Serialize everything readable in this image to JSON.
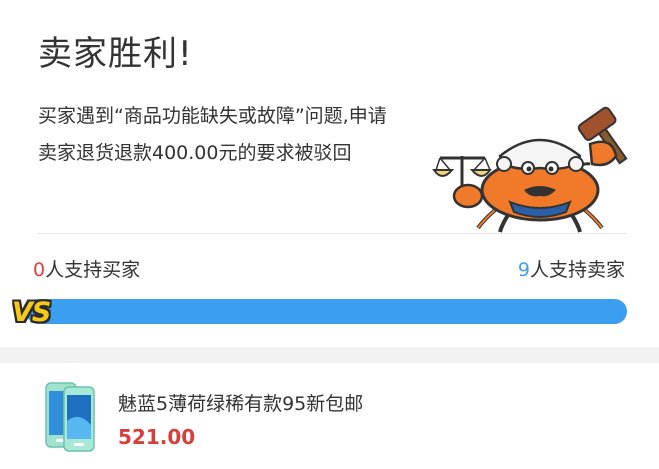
{
  "verdict": {
    "title": "卖家胜利!",
    "description": "买家遇到“商品功能缺失或故障”问题,申请卖家退货退款400.00元的要求被驳回"
  },
  "support": {
    "buyer_count": "0",
    "buyer_label": "人支持买家",
    "seller_count": "9",
    "seller_label": "人支持卖家",
    "seller_share_percent": 100,
    "vs_label": "VS"
  },
  "product": {
    "title": "魅蓝5薄荷绿稀有款95新包邮",
    "price": "521.00"
  },
  "colors": {
    "buyer_accent": "#e0403a",
    "seller_accent": "#3ea0e8",
    "bar_fill": "#3c9ef0",
    "price": "#d6403c",
    "vs_badge": "#f6c818"
  },
  "icons": {
    "mascot": "judge-crab-icon",
    "product_thumb": "phone-thumbnail"
  }
}
